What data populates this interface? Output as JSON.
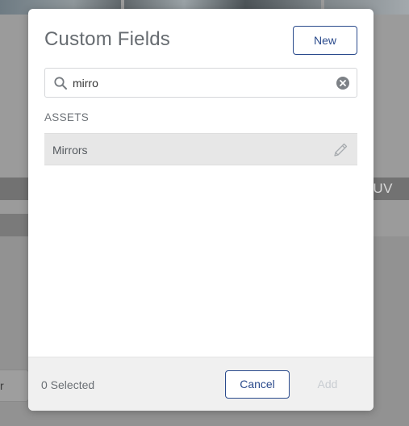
{
  "background": {
    "band_text": "SUV",
    "left_button_text": "r"
  },
  "modal": {
    "title": "Custom Fields",
    "new_label": "New",
    "search": {
      "value": "mirro",
      "placeholder": ""
    },
    "section_label": "ASSETS",
    "results": [
      {
        "label": "Mirrors"
      }
    ],
    "footer": {
      "selected_text": "0 Selected",
      "cancel_label": "Cancel",
      "add_label": "Add"
    }
  },
  "colors": {
    "accent": "#2a4a8c",
    "row_highlight": "#e7e7e7",
    "disabled_text": "#c9cdd2"
  },
  "icons": {
    "search": "search-icon",
    "clear": "clear-circle-icon",
    "edit": "pencil-icon"
  }
}
